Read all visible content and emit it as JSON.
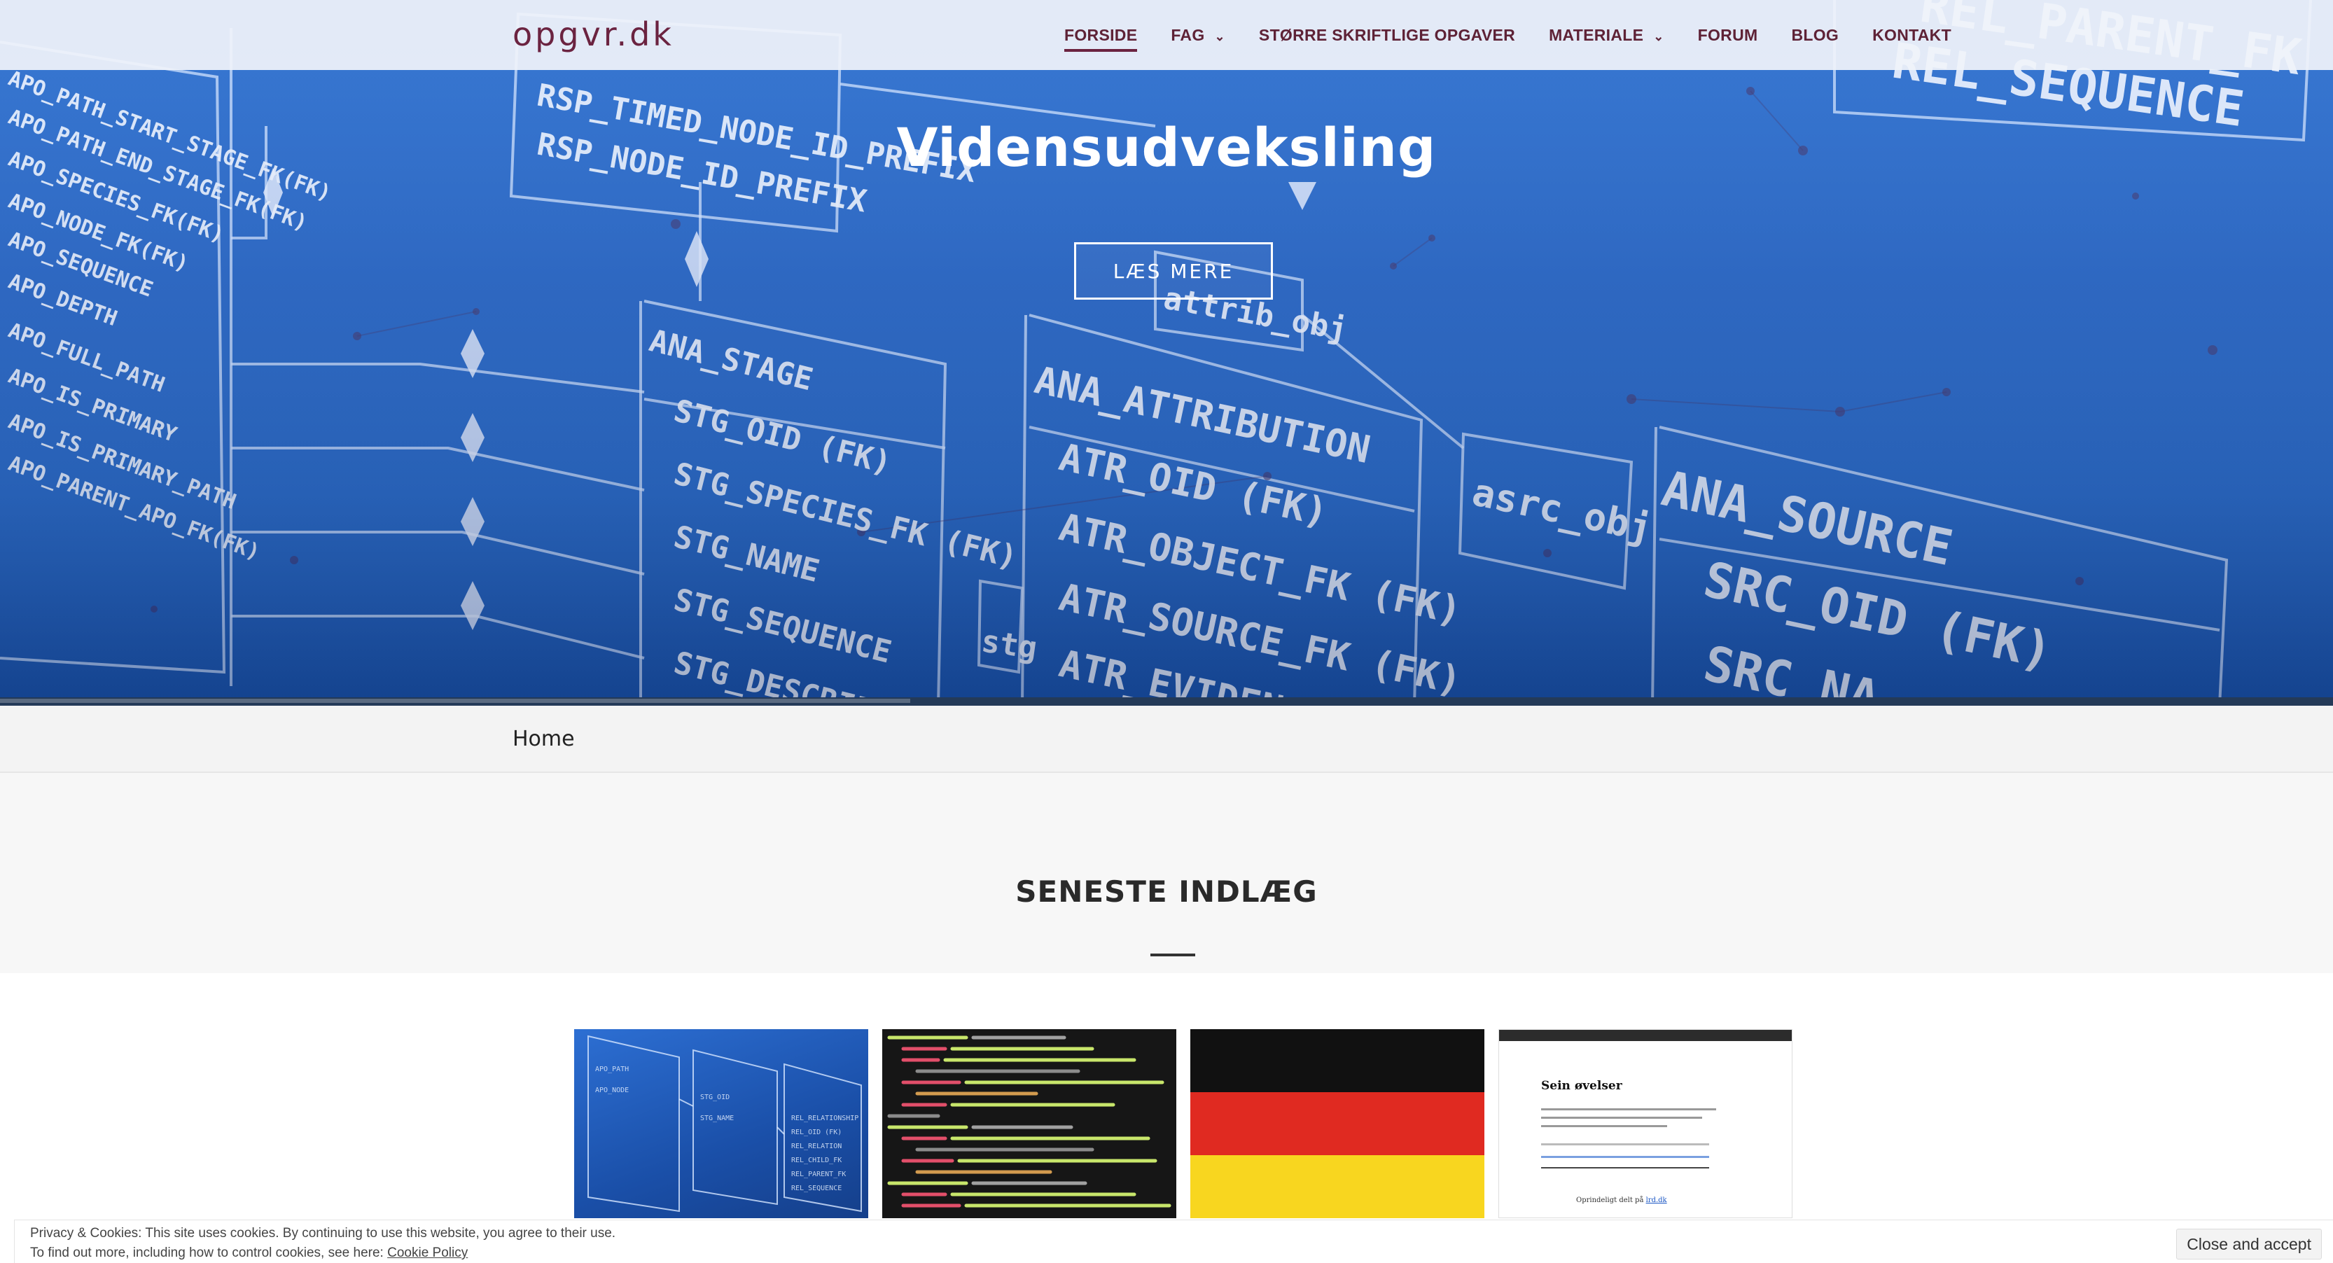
{
  "site": {
    "title": "opgvr.dk"
  },
  "nav": {
    "items": [
      {
        "label": "FORSIDE",
        "active": true,
        "dropdown": false
      },
      {
        "label": "FAG",
        "active": false,
        "dropdown": true
      },
      {
        "label": "STØRRE SKRIFTLIGE OPGAVER",
        "active": false,
        "dropdown": false
      },
      {
        "label": "MATERIALE",
        "active": false,
        "dropdown": true
      },
      {
        "label": "FORUM",
        "active": false,
        "dropdown": false
      },
      {
        "label": "BLOG",
        "active": false,
        "dropdown": false
      },
      {
        "label": "KONTAKT",
        "active": false,
        "dropdown": false
      }
    ]
  },
  "hero": {
    "title": "Vidensudveksling",
    "button_label": "LÆS MERE",
    "diagram_labels": [
      "APO_PATH_START_STAGE_FK(FK)",
      "APO_PATH_END_STAGE_FK(FK)",
      "APO_SPECIES_FK(FK)",
      "APO_NODE_FK(FK)",
      "APO_SEQUENCE",
      "APO_DEPTH",
      "APO_FULL_PATH",
      "APO_IS_PRIMARY",
      "APO_IS_PRIMARY_PATH",
      "APO_PARENT_APO_FK(FK)",
      "RSP_TIMED_NODE_ID_PREFIX",
      "RSP_NODE_ID_PREFIX",
      "ANA_STAGE",
      "STG_OID (FK)",
      "STG_SPECIES_FK(FK)",
      "STG_NAME",
      "STG_SEQUENCE",
      "STG_DESCRIPTI",
      "ANA_ATTRIBUTION",
      "ATR_OID (FK)",
      "ATR_OBJECT_FK (FK)",
      "ATR_SOURCE_FK (FK)",
      "ATR_EVIDENCE",
      "asrc_obj",
      "attrib_obj",
      "ANA_SOURCE",
      "SRC_OID (FK)",
      "SRC_NA",
      "REL_SEQUENCE",
      "REL_PARENT_FK",
      "stg"
    ]
  },
  "breadcrumb": {
    "label": "Home"
  },
  "latest": {
    "heading": "SENESTE INDLÆG",
    "posts": [
      {
        "name": "post-thumb-database"
      },
      {
        "name": "post-thumb-code"
      },
      {
        "name": "post-thumb-german-flag"
      },
      {
        "name": "post-thumb-document",
        "doc_title": "Sein øvelser",
        "doc_caption_prefix": "Oprindeligt delt på ",
        "doc_caption_link": "lrd.dk"
      }
    ]
  },
  "cookie": {
    "line1": "Privacy & Cookies: This site uses cookies. By continuing to use this website, you agree to their use.",
    "line2_prefix": "To find out more, including how to control cookies, see here: ",
    "link": "Cookie Policy",
    "button": "Close and accept"
  },
  "colors": {
    "brand": "#6b2340",
    "hero_blue": "#1e63c6",
    "flag_black": "#111111",
    "flag_red": "#e02a21",
    "flag_gold": "#f8d61f"
  }
}
